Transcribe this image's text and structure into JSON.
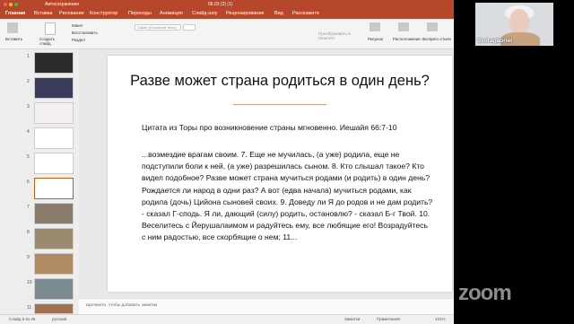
{
  "titlebar": {
    "autosave": "Автосохранение",
    "doc_title": "06.03 (2) (1)"
  },
  "menu": [
    "Главная",
    "Вставка",
    "Рисование",
    "Конструктор",
    "Переходы",
    "Анимация",
    "Слайд-шоу",
    "Рецензирование",
    "Вид",
    "Расскажите"
  ],
  "ribbon": {
    "paste": "Вставить",
    "create_slide": "Создать слайд",
    "layout": "Макет",
    "reset": "Восстановить",
    "section": "Раздел",
    "font_placeholder": "Calibri (Основной текст)",
    "convert_smartart": "Преобразовать в SmartArt",
    "picture": "Рисунок",
    "arrange": "Расположение",
    "styles": "Экспресс-стили"
  },
  "thumbnails": [
    {
      "num": "1",
      "color": "#2b2b2b"
    },
    {
      "num": "2",
      "color": "#3a3a5a"
    },
    {
      "num": "3",
      "color": "#f5f0f0"
    },
    {
      "num": "4",
      "color": "#ffffff"
    },
    {
      "num": "5",
      "color": "#ffffff"
    },
    {
      "num": "6",
      "color": "#ffffff"
    },
    {
      "num": "7",
      "color": "#8a7a6a"
    },
    {
      "num": "8",
      "color": "#9a8a70"
    },
    {
      "num": "9",
      "color": "#b08a60"
    },
    {
      "num": "10",
      "color": "#7a8a90"
    },
    {
      "num": "11",
      "color": "#a07050"
    }
  ],
  "slide": {
    "title": "Разве может страна родиться в один день?",
    "subtitle": "Цитата из Торы про возникновение страны мгновенно. Иешайя 66:7-10",
    "body_lines": [
      "...возмездие врагам своим. 7. Еще не мучилась, (а уже) родила, еще не",
      "подступили боли к ней, (а уже) разрешилась сыном. 8. Кто слышал такое? Кто",
      "видел подобное? Разве может страна мучиться родами (и родить) в один день?",
      "Рождается ли народ в одни раз? А вот (едва начала) мучиться родами, как",
      "родила (дочь) Цийона сыновей своих. 9. Доведу ли Я до родов и не дам родить?",
      "- сказал Г-сподь. Я ли, дающий (силу) родить, остановлю? - сказал Б-г Твой. 10.",
      "Веселитесь с Йерушалаимом и радуйтесь ему, все любящие его! Возрадуйтесь",
      "с ним радостью, все скорбящие о нем; 11..."
    ]
  },
  "notes": "Щелкните, чтобы добавить заметки",
  "status": {
    "slide_info": "Слайд 6 из 26",
    "language": "русский",
    "notes_btn": "Заметки",
    "comments_btn": "Примечания",
    "zoom": "131%"
  },
  "participant": {
    "name": "dvoragabriel"
  },
  "watermark": "zoom"
}
